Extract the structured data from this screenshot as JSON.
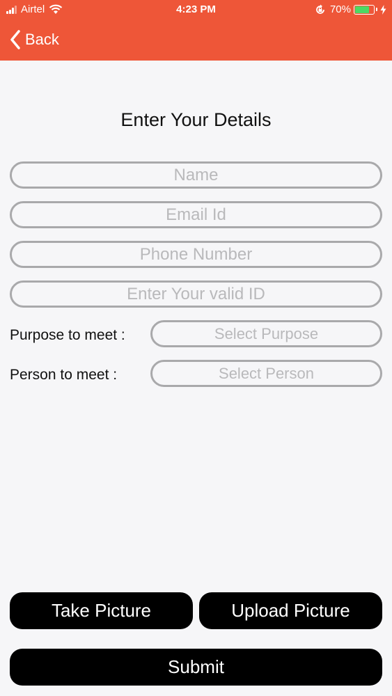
{
  "status_bar": {
    "carrier": "Airtel",
    "time": "4:23 PM",
    "battery_percent": "70%",
    "battery_level": 0.7,
    "battery_color": "#4cd964"
  },
  "nav": {
    "back_label": "Back",
    "background_color": "#ee5638"
  },
  "form": {
    "title": "Enter Your Details",
    "name_placeholder": "Name",
    "email_placeholder": "Email Id",
    "phone_placeholder": "Phone Number",
    "id_placeholder": "Enter Your valid ID",
    "purpose_label": "Purpose to meet :",
    "purpose_placeholder": "Select Purpose",
    "person_label": "Person to meet :",
    "person_placeholder": "Select Person"
  },
  "actions": {
    "take_picture": "Take Picture",
    "upload_picture": "Upload Picture",
    "submit": "Submit"
  },
  "icons": {
    "back": "chevron-left-icon",
    "wifi": "wifi-icon",
    "signal": "signal-icon",
    "orientation_lock": "orientation-lock-icon",
    "battery": "battery-icon",
    "charging": "bolt-icon"
  }
}
